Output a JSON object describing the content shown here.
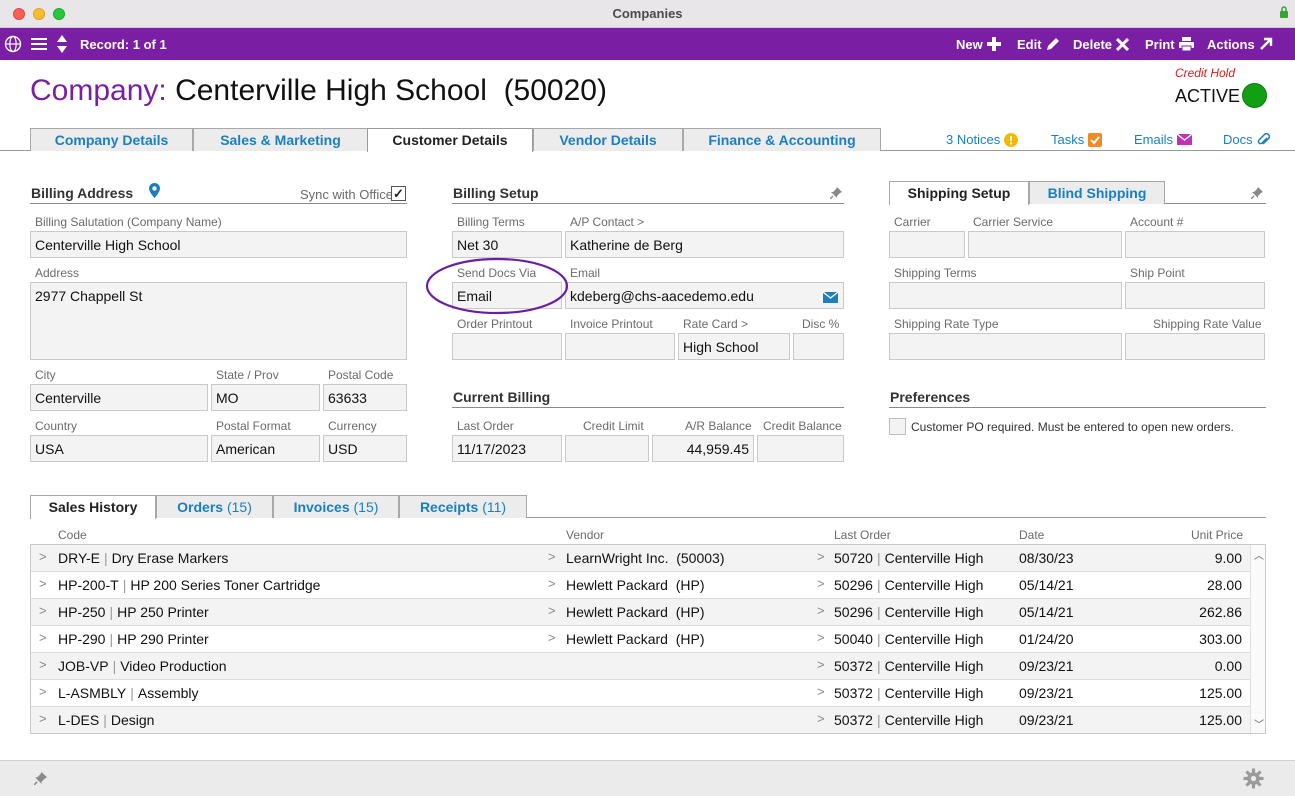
{
  "window": {
    "title": "Companies"
  },
  "toolbar": {
    "record_label": "Record: 1 of 1",
    "new_label": "New",
    "edit_label": "Edit",
    "delete_label": "Delete",
    "print_label": "Print",
    "actions_label": "Actions"
  },
  "header": {
    "label": "Company:",
    "name": "Centerville High School  (50020)",
    "credit_hold": "Credit Hold",
    "status": "ACTIVE",
    "status_color": "#12a012",
    "accent_color": "#7a1fa3"
  },
  "tabs": [
    "Company Details",
    "Sales & Marketing",
    "Customer Details",
    "Vendor Details",
    "Finance & Accounting"
  ],
  "active_tab": "Customer Details",
  "right_links": {
    "notices": "3 Notices",
    "tasks": "Tasks",
    "emails": "Emails",
    "docs": "Docs"
  },
  "billing_address": {
    "title": "Billing Address",
    "sync_label": "Sync with Office",
    "sync_checked": true,
    "salutation_label": "Billing Salutation (Company Name)",
    "salutation": "Centerville High School",
    "address_label": "Address",
    "address": "2977 Chappell St",
    "city_label": "City",
    "city": "Centerville",
    "state_label": "State / Prov",
    "state": "MO",
    "postal_label": "Postal Code",
    "postal": "63633",
    "country_label": "Country",
    "country": "USA",
    "postal_format_label": "Postal Format",
    "postal_format": "American",
    "currency_label": "Currency",
    "currency": "USD"
  },
  "billing_setup": {
    "title": "Billing Setup",
    "terms_label": "Billing Terms",
    "terms": "Net 30",
    "ap_contact_label": "A/P Contact >",
    "ap_contact": "Katherine de Berg",
    "send_docs_label": "Send Docs Via",
    "send_docs": "Email",
    "email_label": "Email",
    "email": "kdeberg@chs-aacedemo.edu",
    "order_printout_label": "Order Printout",
    "order_printout": "",
    "invoice_printout_label": "Invoice Printout",
    "invoice_printout": "",
    "rate_card_label": "Rate Card >",
    "rate_card": "High School",
    "disc_label": "Disc %",
    "disc": ""
  },
  "current_billing": {
    "title": "Current Billing",
    "last_order_label": "Last Order",
    "last_order": "11/17/2023",
    "credit_limit_label": "Credit Limit",
    "credit_limit": "",
    "ar_balance_label": "A/R Balance",
    "ar_balance": "44,959.45",
    "credit_balance_label": "Credit Balance",
    "credit_balance": ""
  },
  "shipping": {
    "tab_setup": "Shipping Setup",
    "tab_blind": "Blind Shipping",
    "carrier_label": "Carrier",
    "carrier": "",
    "carrier_service_label": "Carrier Service",
    "carrier_service": "",
    "account_label": "Account #",
    "account": "",
    "terms_label": "Shipping Terms",
    "terms": "",
    "ship_point_label": "Ship Point",
    "ship_point": "",
    "rate_type_label": "Shipping Rate Type",
    "rate_type": "",
    "rate_value_label": "Shipping Rate Value",
    "rate_value": ""
  },
  "preferences": {
    "title": "Preferences",
    "po_required_label": "Customer PO required. Must be entered to open new orders.",
    "po_required": false
  },
  "history_tabs": {
    "sales": "Sales History",
    "orders": "Orders",
    "orders_count": "(15)",
    "invoices": "Invoices",
    "invoices_count": "(15)",
    "receipts": "Receipts",
    "receipts_count": "(11)"
  },
  "history_columns": {
    "code": "Code",
    "vendor": "Vendor",
    "last_order": "Last Order",
    "date": "Date",
    "unit_price": "Unit Price"
  },
  "history_rows": [
    {
      "code": "DRY-E",
      "desc": "Dry Erase Markers",
      "vendor": "LearnWright Inc.  (50003)",
      "order_no": "50720",
      "order_co": "Centerville High",
      "date": "08/30/23",
      "price": "9.00"
    },
    {
      "code": "HP-200-T",
      "desc": "HP 200 Series Toner Cartridge",
      "vendor": "Hewlett Packard  (HP)",
      "order_no": "50296",
      "order_co": "Centerville High",
      "date": "05/14/21",
      "price": "28.00"
    },
    {
      "code": "HP-250",
      "desc": "HP 250 Printer",
      "vendor": "Hewlett Packard  (HP)",
      "order_no": "50296",
      "order_co": "Centerville High",
      "date": "05/14/21",
      "price": "262.86"
    },
    {
      "code": "HP-290",
      "desc": "HP 290 Printer",
      "vendor": "Hewlett Packard  (HP)",
      "order_no": "50040",
      "order_co": "Centerville High",
      "date": "01/24/20",
      "price": "303.00"
    },
    {
      "code": "JOB-VP",
      "desc": "Video Production",
      "vendor": "",
      "order_no": "50372",
      "order_co": "Centerville High",
      "date": "09/23/21",
      "price": "0.00"
    },
    {
      "code": "L-ASMBLY",
      "desc": "Assembly",
      "vendor": "",
      "order_no": "50372",
      "order_co": "Centerville High",
      "date": "09/23/21",
      "price": "125.00"
    },
    {
      "code": "L-DES",
      "desc": "Design",
      "vendor": "",
      "order_no": "50372",
      "order_co": "Centerville High",
      "date": "09/23/21",
      "price": "125.00"
    }
  ]
}
